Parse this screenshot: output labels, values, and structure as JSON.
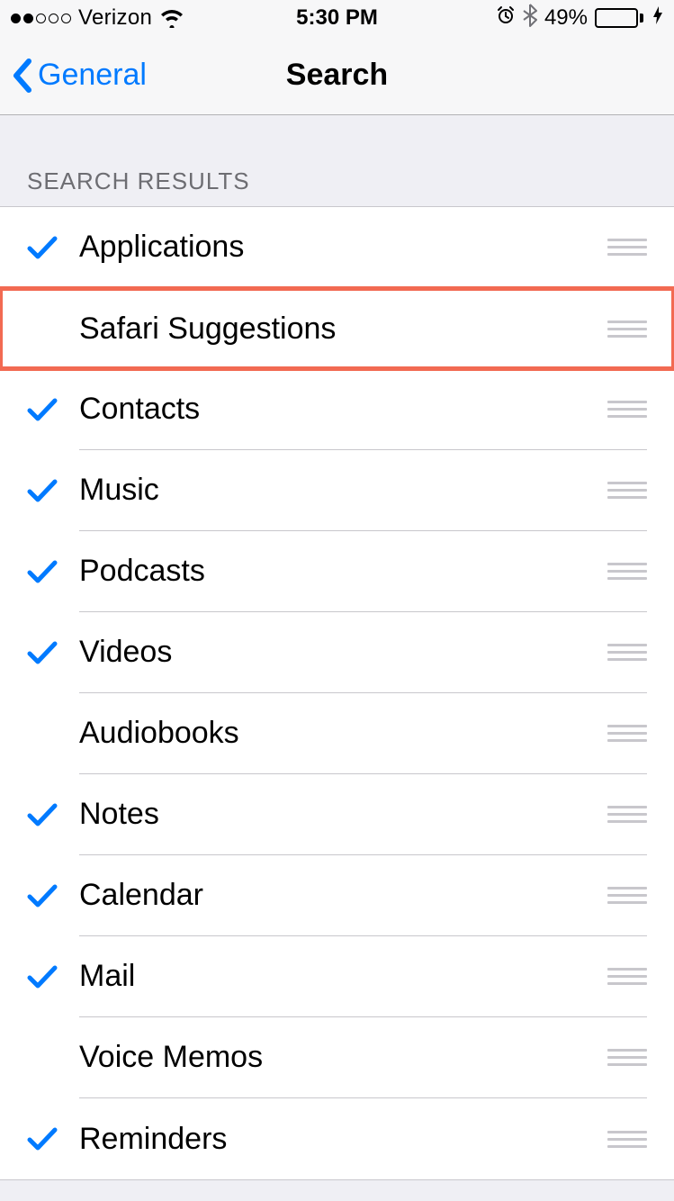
{
  "status": {
    "carrier": "Verizon",
    "time": "5:30 PM",
    "battery_pct": "49%",
    "battery_fill_pct": 49
  },
  "nav": {
    "back_label": "General",
    "title": "Search"
  },
  "section": {
    "header": "SEARCH RESULTS"
  },
  "items": [
    {
      "label": "Applications",
      "checked": true,
      "highlight": false
    },
    {
      "label": "Safari Suggestions",
      "checked": false,
      "highlight": true
    },
    {
      "label": "Contacts",
      "checked": true,
      "highlight": false
    },
    {
      "label": "Music",
      "checked": true,
      "highlight": false
    },
    {
      "label": "Podcasts",
      "checked": true,
      "highlight": false
    },
    {
      "label": "Videos",
      "checked": true,
      "highlight": false
    },
    {
      "label": "Audiobooks",
      "checked": false,
      "highlight": false
    },
    {
      "label": "Notes",
      "checked": true,
      "highlight": false
    },
    {
      "label": "Calendar",
      "checked": true,
      "highlight": false
    },
    {
      "label": "Mail",
      "checked": true,
      "highlight": false
    },
    {
      "label": "Voice Memos",
      "checked": false,
      "highlight": false
    },
    {
      "label": "Reminders",
      "checked": true,
      "highlight": false
    }
  ]
}
